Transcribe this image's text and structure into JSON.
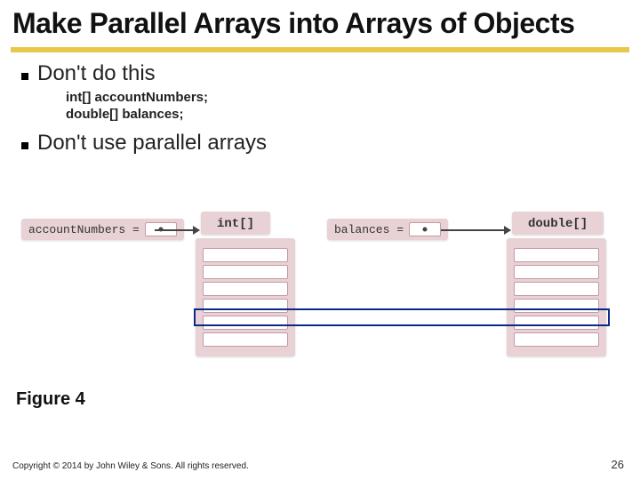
{
  "title": "Make Parallel Arrays into Arrays of Objects",
  "bullets": {
    "b1": "Don't do this",
    "b1_code_line1": "int[] accountNumbers;",
    "b1_code_line2": "double[] balances;",
    "b2": "Don't use parallel arrays"
  },
  "figure": {
    "left_var": "accountNumbers =",
    "left_type": "int[]",
    "right_var": "balances =",
    "right_type": "double[]",
    "cells": 6,
    "caption": "Figure 4"
  },
  "footer": "Copyright © 2014 by John Wiley & Sons. All rights reserved.",
  "page": "26"
}
